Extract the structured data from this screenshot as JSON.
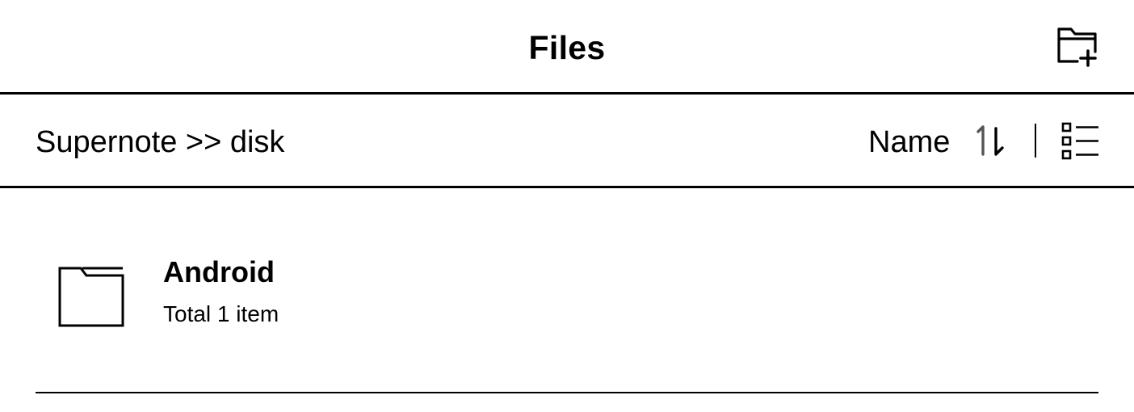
{
  "header": {
    "title": "Files",
    "new_folder_icon": "new-folder-icon"
  },
  "path_bar": {
    "breadcrumb": "Supernote >> disk",
    "sort_label": "Name",
    "sort_icon": "sort-order-icon",
    "view_icon": "list-view-icon"
  },
  "files": [
    {
      "name": "Android",
      "meta": "Total 1 item",
      "icon": "folder-icon"
    }
  ],
  "colors": {
    "background": "#ffffff",
    "foreground": "#000000",
    "sort_up_arrow": "#555555"
  }
}
